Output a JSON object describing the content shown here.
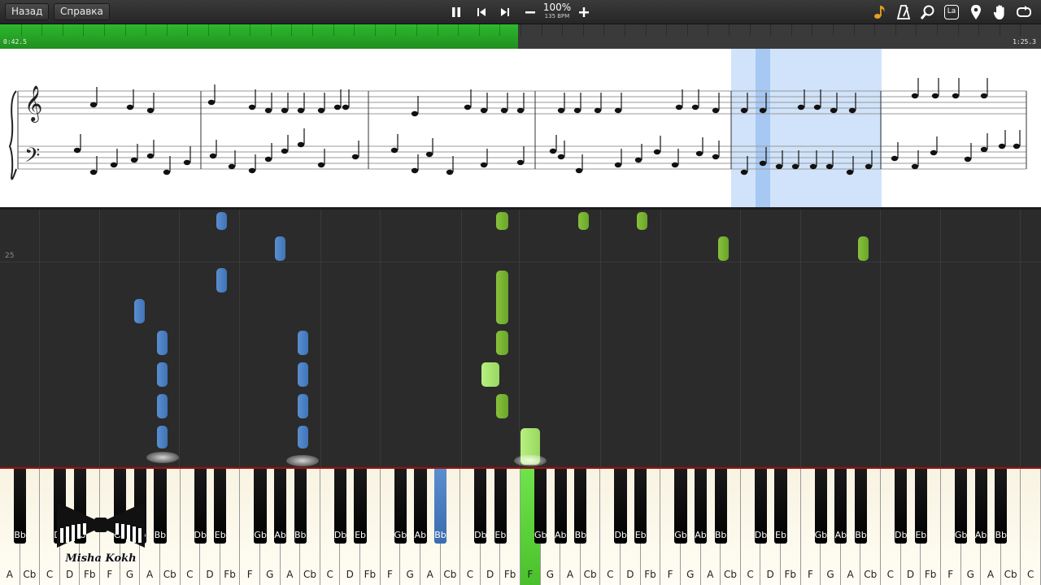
{
  "toolbar": {
    "back_label": "Назад",
    "help_label": "Справка",
    "tempo_percent": "100%",
    "tempo_bpm": "135 BPM",
    "pause_icon": "pause-icon",
    "prev_icon": "skip-back-icon",
    "next_icon": "skip-forward-icon",
    "minus_icon": "minus-icon",
    "plus_icon": "plus-icon",
    "right_icons": [
      "note-icon",
      "metronome-icon",
      "magnifier-icon",
      "key-labels-icon",
      "location-pin-icon",
      "hand-icon",
      "loop-icon"
    ],
    "key_labels_text": "La"
  },
  "progress": {
    "current_time": "0:42.5",
    "total_time": "1:25.3",
    "fraction": 0.498
  },
  "roll": {
    "measure_label": "25"
  },
  "keyboard": {
    "white_keys": [
      "A",
      "Cb",
      "C",
      "D",
      "Fb",
      "F",
      "G",
      "A",
      "Cb",
      "C",
      "D",
      "Fb",
      "F",
      "G",
      "A",
      "Cb",
      "C",
      "D",
      "Fb",
      "F",
      "G",
      "A",
      "Cb",
      "C",
      "D",
      "Fb",
      "F",
      "G",
      "A",
      "Cb",
      "C",
      "D",
      "Fb",
      "F",
      "G",
      "A",
      "Cb",
      "C",
      "D",
      "Fb",
      "F",
      "G",
      "A",
      "Cb",
      "C",
      "D",
      "Fb",
      "F",
      "G",
      "A",
      "Cb",
      "C"
    ],
    "black_keys": [
      "Bb",
      "Db",
      "Eb",
      "Gb",
      "Ab",
      "Bb",
      "Db",
      "Eb",
      "Gb",
      "Ab",
      "Bb",
      "Db",
      "Eb",
      "Gb",
      "Ab",
      "Bb",
      "Db",
      "Eb",
      "Gb",
      "Ab",
      "Bb",
      "Db",
      "Eb",
      "Gb",
      "Ab",
      "Bb",
      "Db",
      "Eb",
      "Gb",
      "Ab",
      "Bb",
      "Db",
      "Eb",
      "Gb",
      "Ab",
      "Bb"
    ],
    "pressed_white_index": 26,
    "pressed_black_index": 15
  },
  "logo": {
    "name": "Misha Kokh"
  },
  "colors": {
    "right_hand": "#6aa52a",
    "left_hand": "#3f74b8",
    "progress": "#2eb82e",
    "highlight": "#a9cdf5"
  }
}
